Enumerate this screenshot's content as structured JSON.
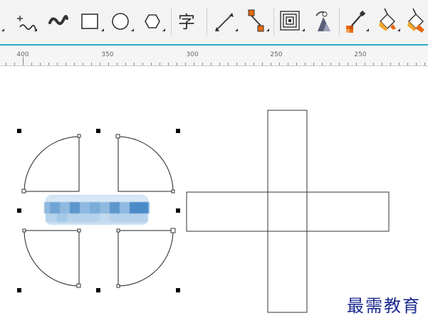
{
  "toolbar": {
    "tools": [
      {
        "name": "freehand-curve-tool"
      },
      {
        "name": "artistic-media-tool"
      },
      {
        "name": "rectangle-tool"
      },
      {
        "name": "ellipse-tool"
      },
      {
        "name": "polygon-tool"
      },
      {
        "name": "text-tool",
        "glyph": "字"
      },
      {
        "name": "dimension-tool"
      },
      {
        "name": "connector-tool"
      },
      {
        "name": "contour-tool"
      },
      {
        "name": "transparency-tool"
      },
      {
        "name": "color-eyedropper-tool"
      },
      {
        "name": "fill-eyedropper-tool"
      },
      {
        "name": "interactive-fill-tool"
      },
      {
        "name": "smart-fill-tool"
      }
    ]
  },
  "ruler": {
    "labels": [
      "400",
      "350",
      "300",
      "250"
    ]
  },
  "watermark": {
    "text": "最需教育"
  },
  "colors": {
    "accent": "#28a7c4",
    "orange": "#e86a10",
    "watermark": "#1b2a8f"
  }
}
